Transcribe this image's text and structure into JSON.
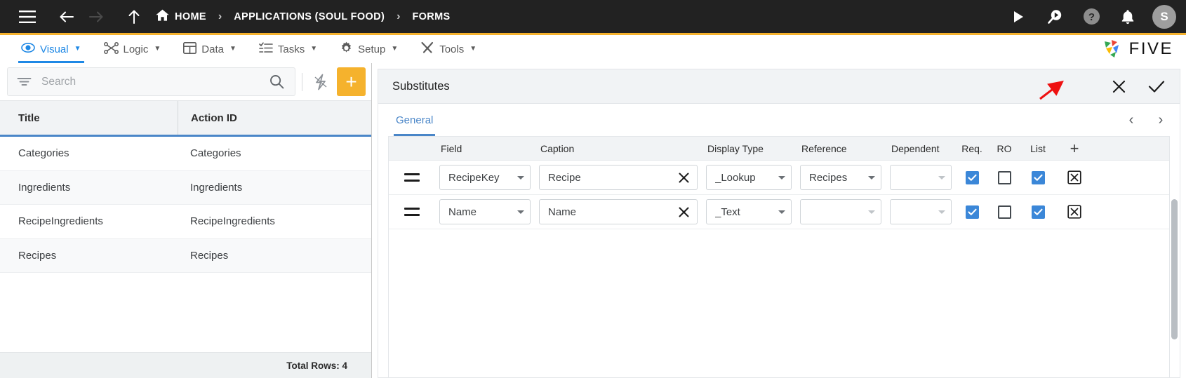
{
  "topbar": {
    "menu_icon": "hamburger-icon",
    "back_icon": "arrow-left-icon",
    "forward_icon": "arrow-right-icon",
    "up_icon": "arrow-up-icon",
    "breadcrumbs": [
      {
        "label": "HOME",
        "icon": "home-icon"
      },
      {
        "label": "APPLICATIONS (SOUL FOOD)",
        "icon": ""
      },
      {
        "label": "FORMS",
        "icon": ""
      }
    ],
    "separator": "›",
    "actions": [
      {
        "name": "run-icon",
        "glyph": "▶"
      },
      {
        "name": "search-play-icon",
        "glyph": ""
      },
      {
        "name": "help-icon",
        "glyph": "?"
      },
      {
        "name": "notifications-bell-icon",
        "glyph": ""
      }
    ],
    "avatar_initial": "S",
    "accent_color": "#f5b22d"
  },
  "menubar": {
    "items": [
      {
        "label": "Visual",
        "icon": "eye-icon",
        "active": true
      },
      {
        "label": "Logic",
        "icon": "nodes-icon",
        "active": false
      },
      {
        "label": "Data",
        "icon": "table-icon",
        "active": false
      },
      {
        "label": "Tasks",
        "icon": "checklist-icon",
        "active": false
      },
      {
        "label": "Setup",
        "icon": "gear-icon",
        "active": false
      },
      {
        "label": "Tools",
        "icon": "tools-icon",
        "active": false
      }
    ],
    "caret": "▼",
    "brand": "FIVE",
    "active_color": "#1e88e5"
  },
  "left_panel": {
    "search": {
      "placeholder": "Search",
      "value": "",
      "filter_icon": "filter-icon",
      "search_icon": "search-icon",
      "flash_icon": "lightning-bolt-icon",
      "add_label": "+"
    },
    "columns": [
      "Title",
      "Action ID"
    ],
    "rows": [
      {
        "title": "Categories",
        "action_id": "Categories"
      },
      {
        "title": "Ingredients",
        "action_id": "Ingredients"
      },
      {
        "title": "RecipeIngredients",
        "action_id": "RecipeIngredients"
      },
      {
        "title": "Recipes",
        "action_id": "Recipes"
      }
    ],
    "footer": "Total Rows: 4"
  },
  "right_panel": {
    "title": "Substitutes",
    "close_icon": "close-x-icon",
    "confirm_icon": "checkmark-icon",
    "tabs": [
      {
        "label": "General",
        "active": true
      }
    ],
    "prev_icon": "‹",
    "next_icon": "›",
    "grid": {
      "columns": [
        "",
        "Field",
        "Caption",
        "Display Type",
        "Reference",
        "Dependent",
        "Req.",
        "RO",
        "List",
        "+"
      ],
      "rows": [
        {
          "drag": "drag-handle",
          "field": "RecipeKey",
          "caption": "Recipe",
          "display_type": "_Lookup",
          "reference": "Recipes",
          "dependent": "",
          "req": true,
          "ro": false,
          "list": true,
          "delete_icon": "delete-row-icon"
        },
        {
          "drag": "drag-handle",
          "field": "Name",
          "caption": "Name",
          "display_type": "_Text",
          "reference": "",
          "dependent": "",
          "req": true,
          "ro": false,
          "list": true,
          "delete_icon": "delete-row-icon"
        }
      ]
    }
  },
  "annotation": {
    "arrow_color": "#ee1111",
    "points_to": "confirm-checkmark-button"
  }
}
